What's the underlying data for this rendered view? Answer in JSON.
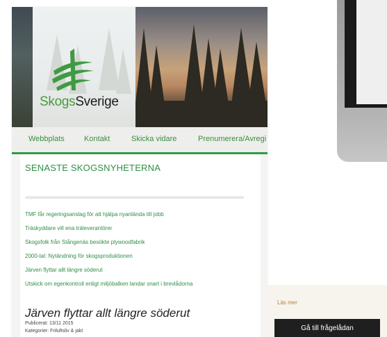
{
  "brand": {
    "name_part1": "Skogs",
    "name_part2": "Sverige"
  },
  "nav": {
    "items": [
      "Webbplats",
      "Kontakt",
      "Skicka vidare",
      "Prenumerera/Avregi"
    ]
  },
  "section": {
    "title": "SENASTE SKOGSNYHETERNA"
  },
  "news": [
    "TMF får regeringsanslag för att hjälpa nyanlända till jobb",
    "Träskyddare vill ena träleverantörer",
    "Skogsfolk från Stångenäs besökte plywoodfabrik",
    "2000-tal: Nytändning för skogsproduktionen",
    "Järven flyttar allt längre söderut",
    "Utskick om egenkontroll enligt miljöbalken landar snart i brevlådorna"
  ],
  "article": {
    "title": "Järven flyttar allt längre söderut",
    "published": "Publicerat: 13/11 2015",
    "categories": "Kategorier: Friluftsliv & jakt"
  },
  "sidebar": {
    "read_more": "Läs mer",
    "cta_button": "Gå till frågelådan"
  },
  "colors": {
    "accent_green": "#2f9a45",
    "button_dark": "#1f1f1f",
    "link_orange": "#b2803f"
  },
  "icons": {
    "logo_mark": "skogssverige-logo-icon"
  }
}
